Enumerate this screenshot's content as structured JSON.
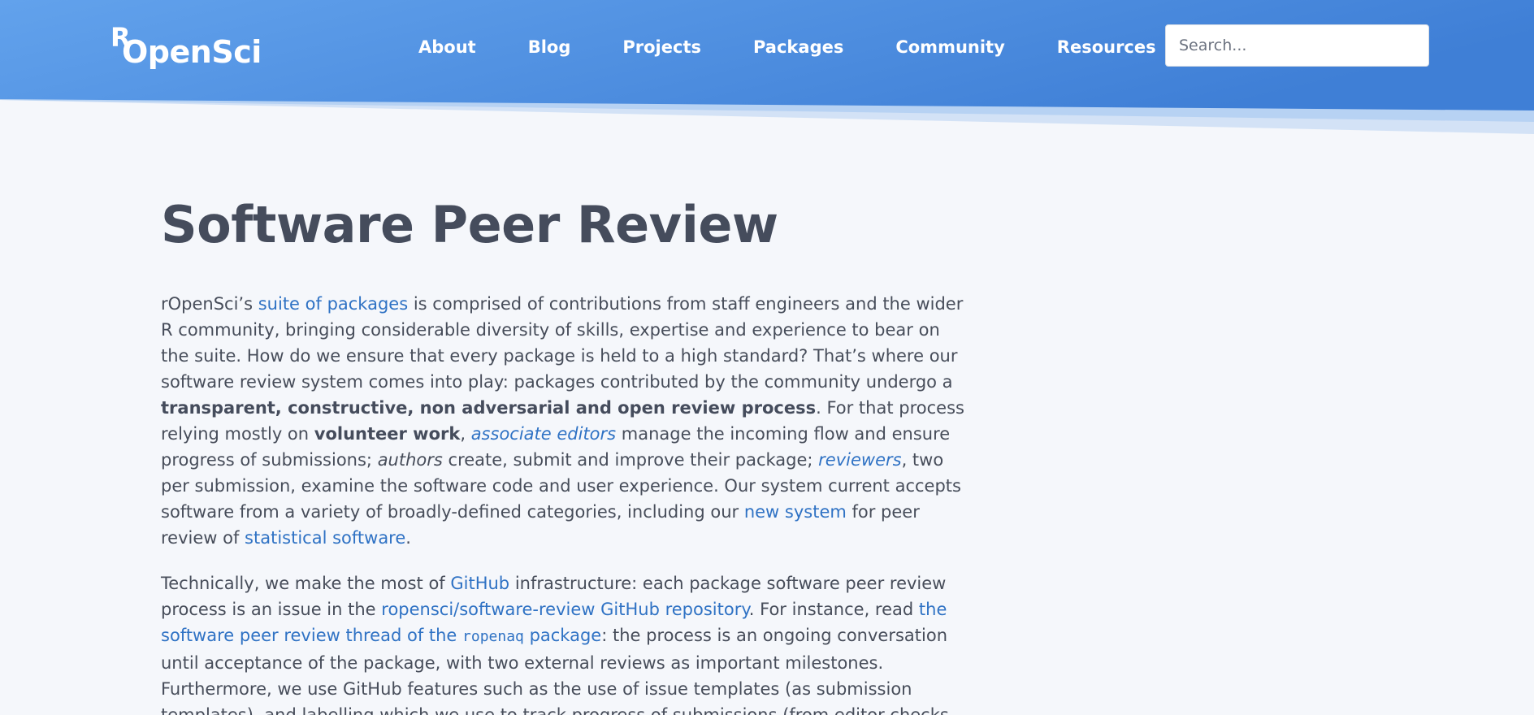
{
  "header": {
    "logo": {
      "r": "R",
      "word": "OpenSci"
    },
    "nav": [
      "About",
      "Blog",
      "Projects",
      "Packages",
      "Community",
      "Resources"
    ],
    "search_placeholder": "Search...",
    "colors": {
      "gradient_start": "#62a2ec",
      "gradient_end": "#3f7fd6",
      "wave_light": "#b7d2f3"
    }
  },
  "main": {
    "title": "Software Peer Review",
    "p1": {
      "l1_a": "rOpenSci’s ",
      "l1_link": "suite of packages",
      "l1_b": " is comprised of contributions from staff engineers and the wider",
      "l2": "R community, bringing considerable diversity of skills, expertise and experience to bear on",
      "l3": "the suite. How do we ensure that every package is held to a high standard? That’s where our",
      "l4": "software review system comes into play: packages contributed by the community undergo a",
      "l5_bold": "transparent, constructive, non adversarial and open review process",
      "l5_b": ". For that process",
      "l6_a": "relying mostly on ",
      "l6_bold": "volunteer work",
      "l6_comma": ", ",
      "l6_link": "associate editors",
      "l6_b": " manage the incoming flow and ensure",
      "l7_a": "progress of submissions; ",
      "l7_italic": "authors",
      "l7_b": " create, submit and improve their package; ",
      "l7_link": "reviewers",
      "l7_c": ", two",
      "l8": "per submission, examine the software code and user experience. Our system current accepts",
      "l9_a": "software from a variety of broadly-defined categories, including our ",
      "l9_link": "new system",
      "l9_b": " for peer",
      "l10_a": "review of ",
      "l10_link": "statistical software",
      "l10_b": "."
    },
    "p2": {
      "l1_a": "Technically, we make the most of ",
      "l1_link": "GitHub",
      "l1_b": " infrastructure: each package software peer review",
      "l2_a": "process is an issue in the ",
      "l2_link": "ropensci/software-review GitHub repository",
      "l2_b": ". For instance, read ",
      "l2_link2": "the",
      "l3_link_a": "software peer review thread of the ",
      "l3_code": "ropenaq",
      "l3_link_b": " package",
      "l3_b": ": the process is an ongoing conversation",
      "l4": "until acceptance of the package, with two external reviews as important milestones.",
      "l5": "Furthermore, we use GitHub features such as the use of issue templates (as submission",
      "l6": "templates), and labelling which we use to track progress of submissions (from editor checks"
    }
  }
}
